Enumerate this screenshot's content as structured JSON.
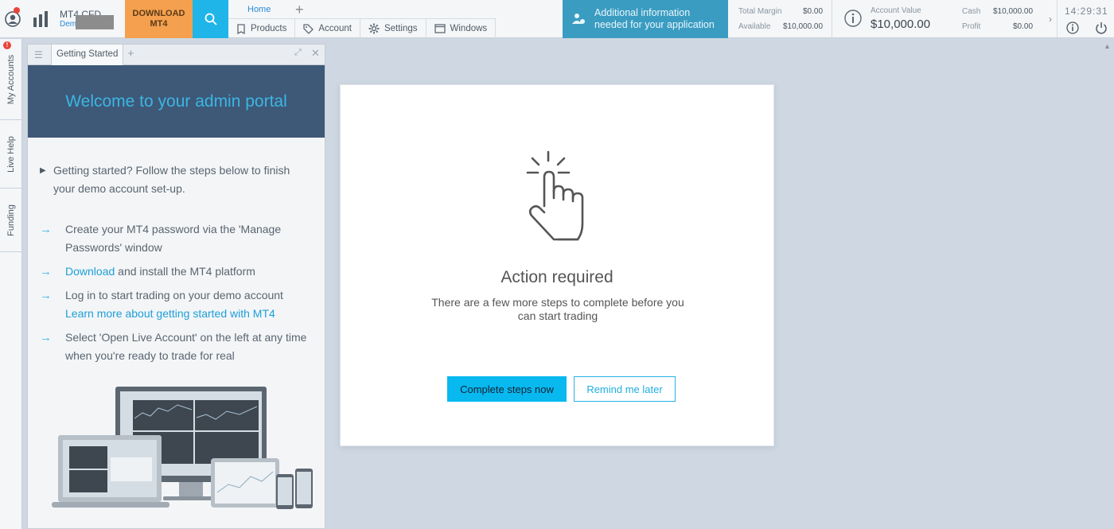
{
  "account": {
    "name": "MT4 CFD",
    "type": "Demo"
  },
  "toolbar": {
    "download_line1": "DOWNLOAD",
    "download_line2": "MT4"
  },
  "nav": {
    "home_tab": "Home",
    "add_tab_symbol": "+",
    "menu": [
      {
        "label": "Products",
        "icon": "products-icon"
      },
      {
        "label": "Account",
        "icon": "tag-icon"
      },
      {
        "label": "Settings",
        "icon": "gear-icon"
      },
      {
        "label": "Windows",
        "icon": "window-icon"
      }
    ]
  },
  "notice": {
    "line1": "Additional information",
    "line2": "needed for your application"
  },
  "margin": {
    "total_margin_label": "Total Margin",
    "total_margin_value": "$0.00",
    "available_label": "Available",
    "available_value": "$10,000.00"
  },
  "account_value": {
    "label": "Account Value",
    "value": "$10,000.00"
  },
  "cash": {
    "cash_label": "Cash",
    "cash_value": "$10,000.00",
    "profit_label": "Profit",
    "profit_value": "$0.00"
  },
  "clock": "14:29:31",
  "side_tabs": [
    {
      "label": "My Accounts"
    },
    {
      "label": "Live Help"
    },
    {
      "label": "Funding"
    }
  ],
  "side_alert": "!",
  "panel": {
    "tab_label": "Getting Started",
    "title": "Welcome to your admin portal",
    "intro": "Getting started? Follow the steps below to finish your demo account set-up.",
    "step1": "Create your MT4 password via the 'Manage Passwords' window",
    "step2_link": "Download",
    "step2_rest": " and install the MT4 platform",
    "step3": "Log in to start trading on your demo account",
    "step3_link": "Learn more about getting started with MT4",
    "step4": "Select 'Open Live Account' on the left at any time when you're ready to trade for real"
  },
  "modal": {
    "title": "Action required",
    "text": "There are a few more steps to complete before you can start trading",
    "primary_button": "Complete steps now",
    "secondary_button": "Remind me later"
  },
  "colors": {
    "accent": "#08b9f0",
    "download": "#f4a04e",
    "notice": "#3b9cc2",
    "panel_header": "#3e5878"
  }
}
